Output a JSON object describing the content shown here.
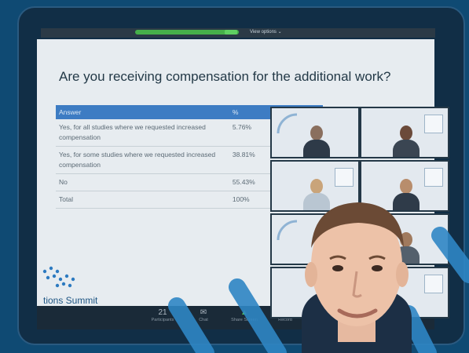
{
  "topbar": {
    "view_options": "View options ⌄"
  },
  "slide": {
    "title": "Are you receiving compensation for the additional work?",
    "table": {
      "headers": [
        "Answer",
        "%"
      ],
      "rows": [
        [
          "Yes, for all studies where we requested increased compensation",
          "5.76%"
        ],
        [
          "Yes, for some studies where we requested increased compensation",
          "38.81%"
        ],
        [
          "No",
          "55.43%"
        ],
        [
          "Total",
          "100%"
        ]
      ]
    },
    "summit_label": "tions Summit"
  },
  "toolbar": {
    "participants_icon": "people-icon",
    "participants_count": "21",
    "participants_label": "Participants",
    "chat_label": "Chat",
    "share_label": "Share Screen",
    "record_label": "Record"
  },
  "colors": {
    "background": "#0f4a73",
    "slide": "#e7ecf0",
    "table_header": "#3d7cc3",
    "stripe": "#2f86c4"
  }
}
